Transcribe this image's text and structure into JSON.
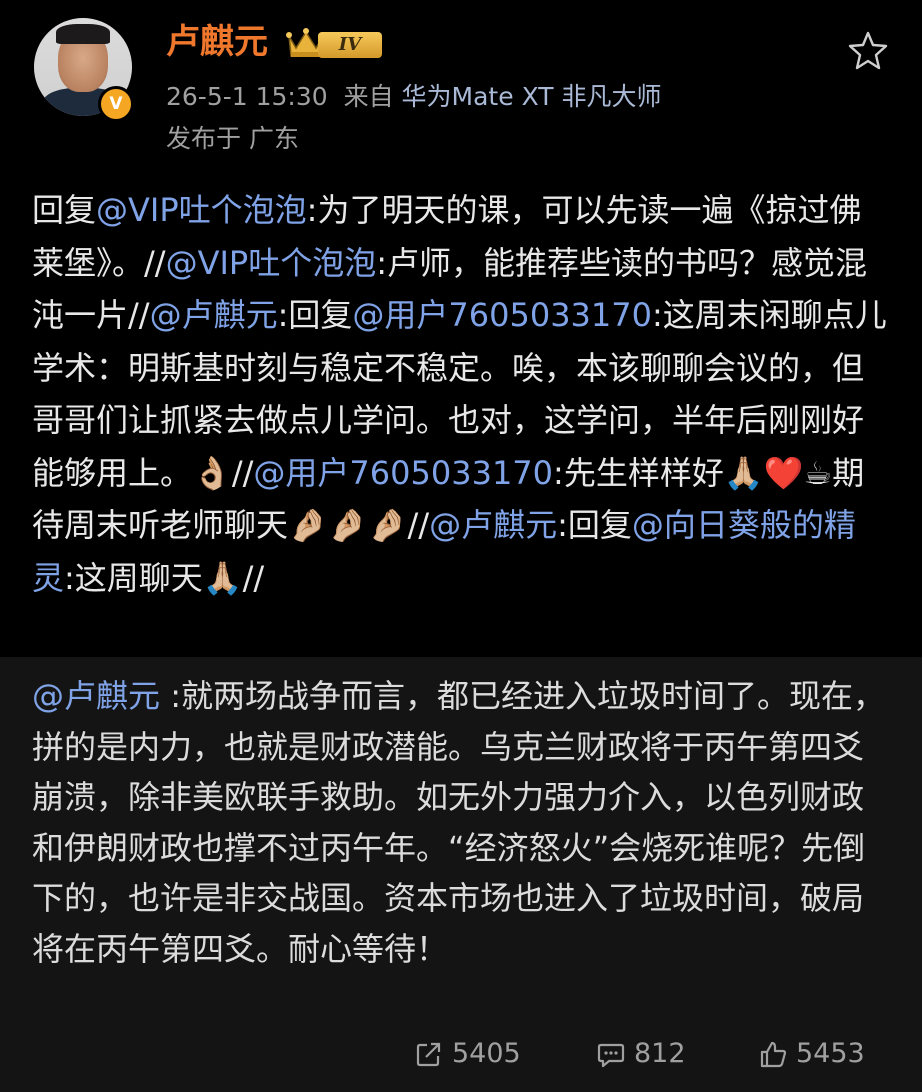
{
  "author": {
    "name": "卢麒元",
    "level": "IV",
    "verified_mark": "V"
  },
  "meta": {
    "timestamp": "26-5-1 15:30",
    "from_prefix": "来自",
    "device": "华为Mate XT 非凡大师",
    "location": "发布于 广东"
  },
  "repost": {
    "segments": [
      {
        "t": "回复",
        "m": false
      },
      {
        "t": "@VIP吐个泡泡",
        "m": true
      },
      {
        "t": ":为了明天的课，可以先读一遍《掠过佛莱堡》。//",
        "m": false
      },
      {
        "t": "@VIP吐个泡泡",
        "m": true
      },
      {
        "t": ":卢师，能推荐些读的书吗？感觉混沌一片//",
        "m": false
      },
      {
        "t": "@卢麒元",
        "m": true
      },
      {
        "t": ":回复",
        "m": false
      },
      {
        "t": "@用户7605033170",
        "m": true
      },
      {
        "t": ":这周末闲聊点儿学术：明斯基时刻与稳定不稳定。唉，本该聊聊会议的，但哥哥们让抓紧去做点儿学问。也对，这学问，半年后刚刚好能够用上。👌🏼//",
        "m": false
      },
      {
        "t": "@用户7605033170",
        "m": true
      },
      {
        "t": ":先生样样好🙏🏼❤️☕期待周末听老师聊天🤌🏼🤌🏼🤌🏼//",
        "m": false
      },
      {
        "t": "@卢麒元",
        "m": true
      },
      {
        "t": ":回复",
        "m": false
      },
      {
        "t": "@向日葵般的精灵",
        "m": true
      },
      {
        "t": ":这周聊天🙏🏼//",
        "m": false
      }
    ]
  },
  "quoted": {
    "mention": "@卢麒元",
    "text": " :就两场战争而言，都已经进入垃圾时间了。现在，拼的是内力，也就是财政潜能。乌克兰财政将于丙午第四爻崩溃，除非美欧联手救助。如无外力强力介入，以色列财政和伊朗财政也撑不过丙午年。“经济怒火”会烧死谁呢？先倒下的，也许是非交战国。资本市场也进入了垃圾时间，破局将在丙午第四爻。耐心等待！"
  },
  "actions": {
    "reposts": "5405",
    "comments": "812",
    "likes": "5453"
  },
  "colors": {
    "background": "#000000",
    "author_name": "#f0782d",
    "mention": "#7fa3e6",
    "quoted_bg": "#141414",
    "secondary_text": "#a0a0a0"
  },
  "icons": [
    "star-icon",
    "repost-icon",
    "comment-icon",
    "like-icon",
    "crown-icon",
    "verified-icon"
  ]
}
